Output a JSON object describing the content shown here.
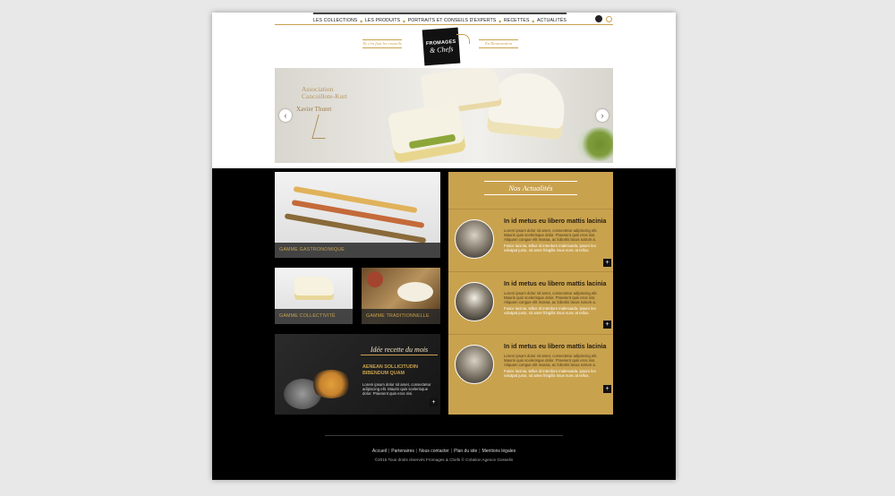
{
  "nav": {
    "items": [
      "LES COLLECTIONS",
      "LES PRODUITS",
      "PORTRAITS ET CONSEILS D'EXPERTS",
      "RECETTES",
      "ACTUALITÉS"
    ],
    "cart_icon": "cart-icon",
    "search_icon": "search-icon"
  },
  "sublinks": {
    "left": "Ils s'en font les conseils",
    "right": "En Restauration"
  },
  "logo": {
    "line1": "FROMAGES",
    "line2": "& Chefs"
  },
  "hero": {
    "text_line1": "Association",
    "text_line2": "Cancoillote-Kurt",
    "chef": "Xavier Thuret",
    "prev_label": "‹",
    "next_label": "›"
  },
  "tiles": {
    "gastro": "GAMME GASTRONOMIQUE",
    "collectivite": "GAMME COLLECTIVITÉ",
    "traditionnelle": "GAMME TRADITIONNELLE"
  },
  "recipe": {
    "title": "Idée recette du mois",
    "subtitle": "AENEAN SOLLICITUDIN BIBENDUM QUAM",
    "body": "Lorem ipsum dolor sit amet, consectetur adipiscing elit. Mauris quis scelerisque dolor. Praesent quis eros nisi.",
    "more": "+"
  },
  "news": {
    "title": "Nos Actualités",
    "items": [
      {
        "heading": "In id metus eu libero mattis lacinia",
        "body": "Lorem ipsum dolor sit amet, consectetur adipiscing elit. Mauris quis scelerisque dolor. Praesent quis eros nisi. Aliquam congue elit massa, ac lobortis lacus rutrum a.",
        "body2": "Fusce lacinia, tellus id interdum malesuada, ipsum leo volutpat justo, sit amet fringilla risus nunc at tellus.",
        "more": "+"
      },
      {
        "heading": "In id metus eu libero mattis lacinia",
        "body": "Lorem ipsum dolor sit amet, consectetur adipiscing elit. Mauris quis scelerisque dolor. Praesent quis eros nisi. Aliquam congue elit massa, ac lobortis lacus rutrum a.",
        "body2": "Fusce lacinia, tellus id interdum malesuada, ipsum leo volutpat justo, sit amet fringilla risus nunc at tellus.",
        "more": "+"
      },
      {
        "heading": "In id metus eu libero mattis lacinia",
        "body": "Lorem ipsum dolor sit amet, consectetur adipiscing elit. Mauris quis scelerisque dolor. Praesent quis eros nisi. Aliquam congue elit massa, ac lobortis lacus rutrum a.",
        "body2": "Fusce lacinia, tellus id interdum malesuada, ipsum leo volutpat justo, sit amet fringilla risus nunc at tellus.",
        "more": "+"
      }
    ]
  },
  "footer": {
    "links": [
      "Accueil",
      "Partenaires",
      "Nous contacter",
      "Plan du site",
      "Mentions légales"
    ],
    "copyright": "©2015 Tous droits réservés Fromages & Chefs © Création Agence Gosselin"
  },
  "colors": {
    "gold": "#c9a24e",
    "black": "#000000",
    "white": "#ffffff"
  }
}
